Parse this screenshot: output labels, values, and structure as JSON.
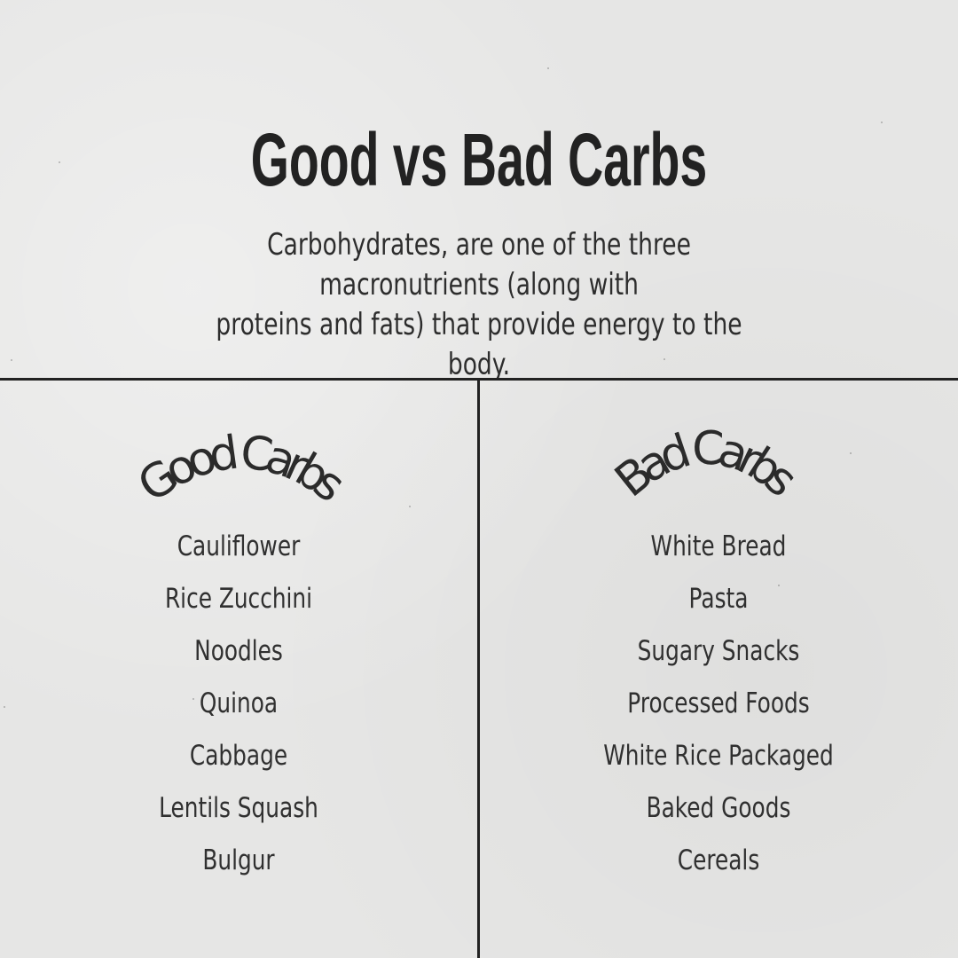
{
  "header": {
    "title": "Good vs Bad Carbs",
    "subtitle_line1": "Carbohydrates, are one of the three macronutrients (along with",
    "subtitle_line2": "proteins and fats) that provide energy to the body."
  },
  "good": {
    "heading": "Good Carbs",
    "items": [
      "Cauliflower",
      "Rice Zucchini",
      "Noodles",
      "Quinoa",
      "Cabbage",
      "Lentils Squash",
      "Bulgur"
    ]
  },
  "bad": {
    "heading": "Bad Carbs",
    "items": [
      "White Bread",
      "Pasta",
      "Sugary Snacks",
      "Processed Foods",
      "White Rice Packaged",
      "Baked Goods",
      "Cereals"
    ]
  },
  "colors": {
    "background": "#e6e6e5",
    "text": "#222222",
    "divider": "#222222"
  }
}
